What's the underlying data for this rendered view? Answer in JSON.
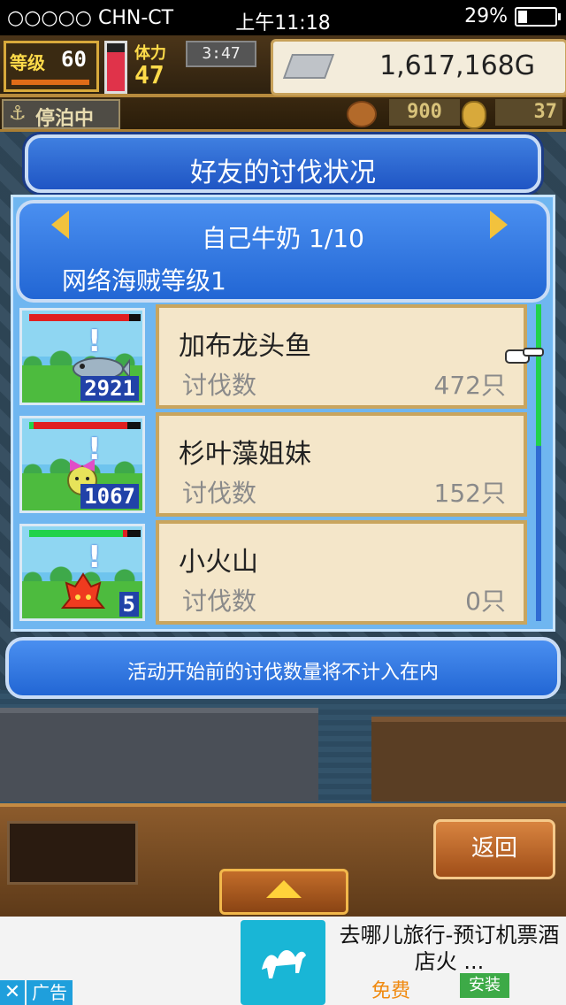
{
  "status_bar": {
    "carrier": "○○○○○ CHN-CT",
    "time": "上午11:18",
    "battery": "29%"
  },
  "hud": {
    "level_label": "等级",
    "level": "60",
    "stamina_label": "体力",
    "stamina": "47",
    "timer": "3:47",
    "gold": "1,617,168G",
    "docked": "停泊中",
    "food": "900",
    "coins": "37"
  },
  "dialog": {
    "title": "好友的讨伐状况",
    "friend": "自己牛奶 1/10",
    "rank": "网络海贼等级1",
    "rows": [
      {
        "name": "加布龙头鱼",
        "label": "讨伐数",
        "value": "472只",
        "count": "2921",
        "hp_red": 0.9
      },
      {
        "name": "杉叶藻姐妹",
        "label": "讨伐数",
        "value": "152只",
        "count": "1067",
        "hp_red": 0.84
      },
      {
        "name": "小火山",
        "label": "讨伐数",
        "value": "0只",
        "count": "5",
        "hp_red": 0.04
      }
    ],
    "notice": "活动开始前的讨伐数量将不计入在内"
  },
  "bottom": {
    "back": "返回"
  },
  "ad": {
    "title": "去哪儿旅行-预订机票酒店火 ...",
    "free": "免费",
    "install": "安装",
    "tag": "广告",
    "close": "✕"
  },
  "colors": {
    "accent_blue": "#2266d4",
    "gold_arrow": "#f2c23d",
    "card_bg": "#f4e6c9"
  }
}
